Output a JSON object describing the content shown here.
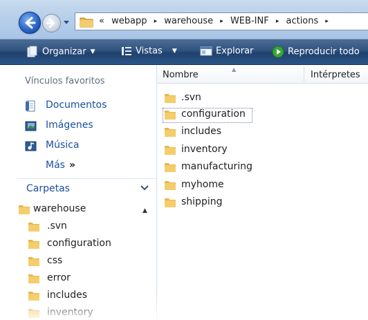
{
  "address_bar": {
    "breadcrumb": [
      "webapp",
      "warehouse",
      "WEB-INF",
      "actions"
    ],
    "overflow": "«",
    "separator": "▸"
  },
  "toolbar": {
    "organize_label": "Organizar",
    "views_label": "Vistas",
    "explore_label": "Explorar",
    "play_label": "Reproducir todo",
    "arrow": "▼"
  },
  "nav_pane": {
    "favorites_header": "Vínculos favoritos",
    "favorites": [
      {
        "label": "Documentos",
        "icon": "documents-icon"
      },
      {
        "label": "Imágenes",
        "icon": "pictures-icon"
      },
      {
        "label": "Música",
        "icon": "music-icon"
      }
    ],
    "more_label": "Más",
    "more_arrows": "»",
    "folders_header": "Carpetas",
    "tree": [
      {
        "label": "warehouse",
        "level": 0
      },
      {
        "label": ".svn",
        "level": 1
      },
      {
        "label": "configuration",
        "level": 1
      },
      {
        "label": "css",
        "level": 1
      },
      {
        "label": "error",
        "level": 1
      },
      {
        "label": "includes",
        "level": 1
      },
      {
        "label": "inventory",
        "level": 1
      }
    ]
  },
  "content": {
    "columns": {
      "name": "Nombre",
      "artists": "Intérpretes"
    },
    "files": [
      ".svn",
      "configuration",
      "includes",
      "inventory",
      "manufacturing",
      "myhome",
      "shipping"
    ],
    "focused_index": 1
  },
  "colors": {
    "toolbar": "#2f527f",
    "link": "#1a4fa1",
    "folder": "#e8b64a"
  }
}
